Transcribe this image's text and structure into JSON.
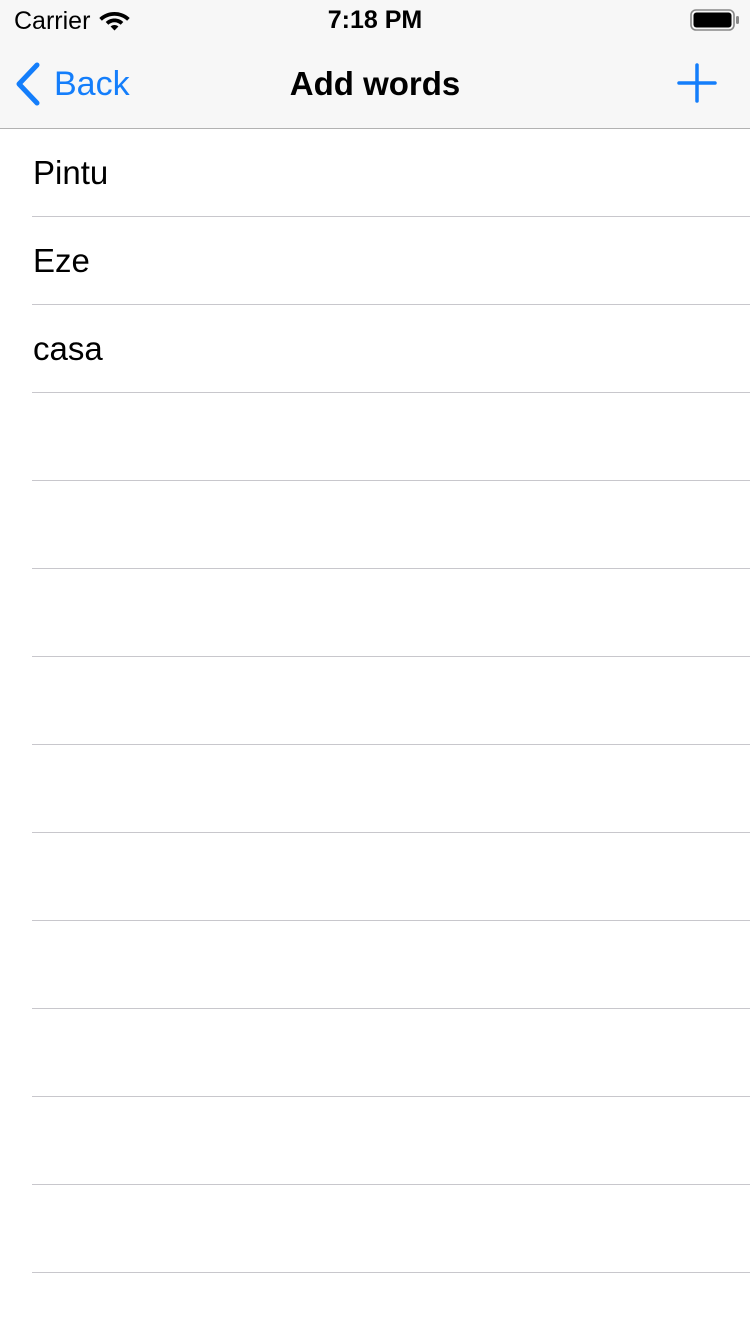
{
  "status_bar": {
    "carrier": "Carrier",
    "time": "7:18 PM",
    "wifi_icon": "wifi-icon",
    "battery_icon": "battery-full-icon"
  },
  "nav": {
    "back_label": "Back",
    "title": "Add words",
    "add_icon": "plus-icon",
    "accent_color": "#147efb"
  },
  "words": [
    "Pintu",
    "Eze",
    "casa",
    "",
    "",
    "",
    "",
    "",
    "",
    "",
    "",
    "",
    "",
    ""
  ]
}
